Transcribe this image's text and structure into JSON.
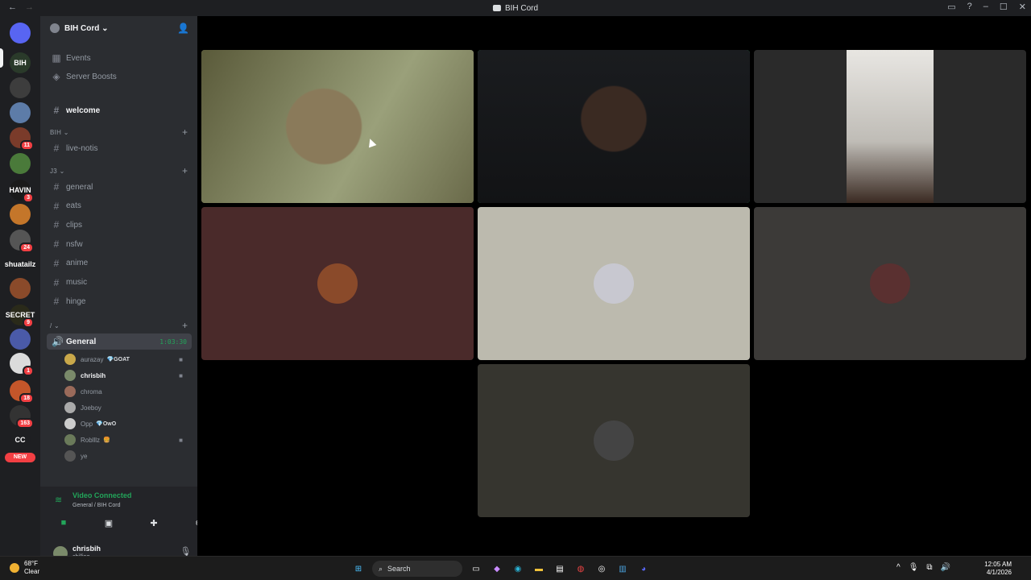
{
  "window": {
    "title": "BIH Cord"
  },
  "server_rail": [
    {
      "name": "discord-home",
      "label": "",
      "color": "#5865f2",
      "count": ""
    },
    {
      "name": "bih-cord",
      "label": "BIH",
      "color": "#2a3a2a",
      "count": ""
    },
    {
      "name": "server-3",
      "label": "",
      "color": "#3d3d3d",
      "count": ""
    },
    {
      "name": "server-4",
      "label": "",
      "color": "#5d7ca8",
      "count": ""
    },
    {
      "name": "server-5",
      "label": "",
      "color": "#7a3b2a",
      "count": "11"
    },
    {
      "name": "server-6",
      "label": "",
      "color": "#4a7a3a",
      "count": ""
    },
    {
      "name": "havin",
      "label": "HAVIN",
      "color": "#1a1a1a",
      "count": "3"
    },
    {
      "name": "server-8",
      "label": "",
      "color": "#c4762a",
      "count": ""
    },
    {
      "name": "server-9",
      "label": "",
      "color": "#555",
      "count": "24"
    },
    {
      "name": "skateboard",
      "label": "shuatailz",
      "color": "#1e1f22",
      "count": ""
    },
    {
      "name": "server-11",
      "label": "",
      "color": "#8a4a2a",
      "count": ""
    },
    {
      "name": "secret",
      "label": "SECRET",
      "color": "#2a2a1a",
      "count": "9"
    },
    {
      "name": "server-13",
      "label": "",
      "color": "#4a5aa8",
      "count": ""
    },
    {
      "name": "server-14",
      "label": "",
      "color": "#dbdbdb",
      "count": "1"
    },
    {
      "name": "server-15",
      "label": "",
      "color": "#c4562a",
      "count": "18"
    },
    {
      "name": "server-16",
      "label": "",
      "color": "#333",
      "count": "163"
    },
    {
      "name": "cc",
      "label": "CC",
      "color": "#1e1f22",
      "count": ""
    }
  ],
  "new_badge": "NEW",
  "guild": {
    "name": "BIH Cord ⌄"
  },
  "top_items": [
    {
      "label": "Events",
      "icon": "calendar-icon"
    },
    {
      "label": "Server Boosts",
      "icon": "boost-icon"
    }
  ],
  "welcome": "welcome",
  "categories": [
    {
      "label": "BIH ⌄",
      "channels": [
        "live-notis"
      ]
    },
    {
      "label": "J3 ⌄",
      "channels": [
        "general",
        "eats",
        "clips",
        "nsfw",
        "anime",
        "music",
        "hinge"
      ]
    },
    {
      "label": "/ ⌄",
      "channels": []
    }
  ],
  "voice_channel": {
    "name": "General",
    "timer": "1:03:30"
  },
  "voice_users": [
    {
      "name": "aurazay",
      "tag": "💎GOAT",
      "cam": true,
      "color": "#c9a84a"
    },
    {
      "name": "chrisbih",
      "tag": "",
      "cam": true,
      "me": true,
      "color": "#7a8a6a"
    },
    {
      "name": "chroma",
      "tag": "",
      "cam": false,
      "color": "#9a6a5a"
    },
    {
      "name": "Joeboy",
      "tag": "",
      "cam": false,
      "color": "#aaa"
    },
    {
      "name": "Opp",
      "tag": "💎OwO",
      "cam": false,
      "color": "#ccc"
    },
    {
      "name": "Roblllz",
      "tag": "🍔",
      "cam": true,
      "color": "#6a7a5a"
    },
    {
      "name": "ye",
      "tag": "",
      "cam": false,
      "color": "#555"
    }
  ],
  "rtc": {
    "status": "Video Connected",
    "sub": "General / BIH Cord"
  },
  "user": {
    "name": "chrisbih",
    "status": "chilling"
  },
  "tiles": [
    {
      "name": "video-tile-1",
      "kind": "video",
      "bg": "#6c6a4a"
    },
    {
      "name": "video-tile-2",
      "kind": "video",
      "bg": "#1c1d20",
      "speaking": true
    },
    {
      "name": "video-tile-3",
      "kind": "video",
      "bg": "#2a2a2a"
    },
    {
      "name": "avatar-tile-1",
      "kind": "avatar",
      "bg": "#4a2a2a",
      "avatar": "#8a4a2a"
    },
    {
      "name": "avatar-tile-2",
      "kind": "avatar",
      "bg": "#bcbaae",
      "avatar": "#c8c8d0"
    },
    {
      "name": "avatar-tile-3",
      "kind": "avatar",
      "bg": "#3c3a38",
      "avatar": "#5a3030"
    },
    {
      "name": "avatar-tile-4",
      "kind": "avatar",
      "bg": "#36352f",
      "avatar": "#444"
    }
  ],
  "taskbar": {
    "temp": "68°F",
    "weather": "Clear",
    "search": "Search",
    "time": "12:05 AM",
    "date": "4/1/2026"
  }
}
